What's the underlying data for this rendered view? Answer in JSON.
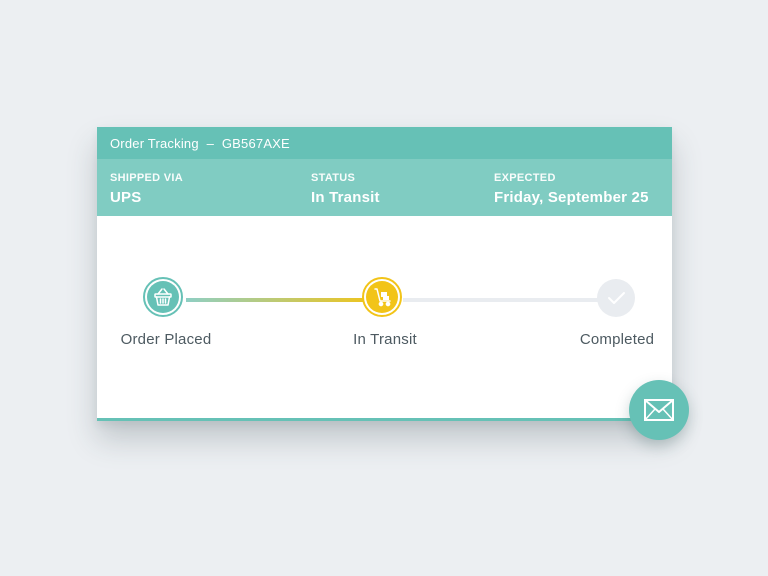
{
  "header": {
    "title": "Order Tracking",
    "separator": "–",
    "order_id": "GB567AXE"
  },
  "info": {
    "shipped_via_label": "SHIPPED VIA",
    "shipped_via_value": "UPS",
    "status_label": "STATUS",
    "status_value": "In Transit",
    "expected_label": "EXPECTED",
    "expected_value": "Friday, September 25"
  },
  "steps": [
    {
      "label": "Order Placed",
      "icon": "basket-icon",
      "state": "done"
    },
    {
      "label": "In Transit",
      "icon": "hand-truck-icon",
      "state": "current"
    },
    {
      "label": "Completed",
      "icon": "checkmark-icon",
      "state": "pending"
    }
  ],
  "actions": {
    "email_icon": "envelope-icon"
  },
  "colors": {
    "teal": "#66c1b6",
    "teal_light": "#80ccc2",
    "yellow": "#f2c418",
    "pending": "#e9ecf0",
    "background": "#eceff2"
  }
}
